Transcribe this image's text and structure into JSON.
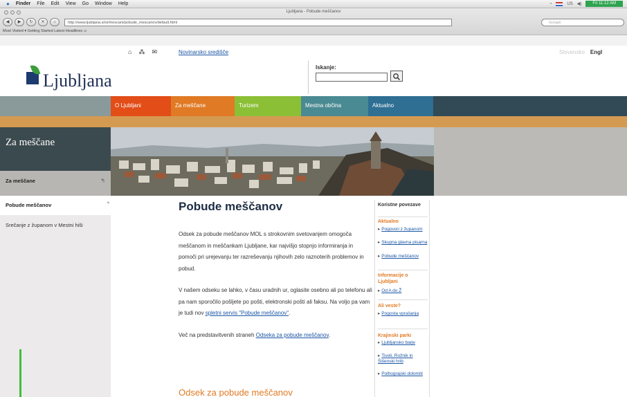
{
  "os_menubar": {
    "apple": "",
    "items": [
      "Finder",
      "File",
      "Edit",
      "View",
      "Go",
      "Window",
      "Help"
    ],
    "status": "US",
    "clock": "Fri 11:12 AM"
  },
  "browser": {
    "window_title": "Ljubljana - Pobude meščanov",
    "url": "http://www.ljubljana.si/si/mescani/pobude_mescanov/default.html",
    "search_placeholder": "Google",
    "bookmarks": "Most Visited ▾   Getting Started   Latest Headlines ⊃"
  },
  "utility": {
    "press_link": "Novinarsko središče",
    "lang_inactive": "Slovensko",
    "lang_active": "Engl"
  },
  "header": {
    "logo_text": "Ljubljana",
    "search_label": "Iskanje:",
    "search_value": ""
  },
  "nav": {
    "tabs": [
      "O Ljubljani",
      "Za meščane",
      "Turizem",
      "Mestna občina",
      "Aktualno"
    ]
  },
  "banner": {
    "title": "Za meščane"
  },
  "sidebar": {
    "section": "Za meščane",
    "active": "Pobude meščanov",
    "sub_item": "Srečanje z županom v Mestni hiši"
  },
  "content": {
    "title": "Pobude meščanov",
    "p1": "Odsek za pobude meščanov MOL s strokovnim svetovanjem omogoča meščanom in meščankam Ljubljane, kar najvišjo stopnjo informiranja in pomoči pri urejevanju ter razreševanju njihovih zelo raznoterih problemov in pobud.",
    "p2_text": "V našem odseku se lahko, v času uradnih ur, oglasite osebno ali po telefonu ali pa nam sporočilo pošljete po pošti, elektronski pošti ali faksu. Na voljo pa vam je tudi nov ",
    "p2_link": "spletni servis \"Pobude meščanov\"",
    "p2_end": ".",
    "p3_text": "Več na predstavitvenih straneh ",
    "p3_link": "Odseka za pobude meščanov",
    "p3_end": ".",
    "subheading": "Odsek za pobude meščanov"
  },
  "rightbox": {
    "title": "Koristne povezave",
    "sect1": "Aktualno",
    "links1": [
      "Pogovori z županom",
      "Skupna glavna pisarna",
      "Pobude meščanov"
    ],
    "sect2": "Informacije o Ljubljani",
    "links2": [
      "Od A do Ž"
    ],
    "sect3": "Ali veste?",
    "links3": [
      "Pogosta vprašanja"
    ],
    "sect4": "Krajinski parki",
    "links4": [
      "Ljubljansko barje",
      "Tivoli, Rožnik in Šišenski hrib",
      "Polhograjski dolomiti"
    ]
  }
}
